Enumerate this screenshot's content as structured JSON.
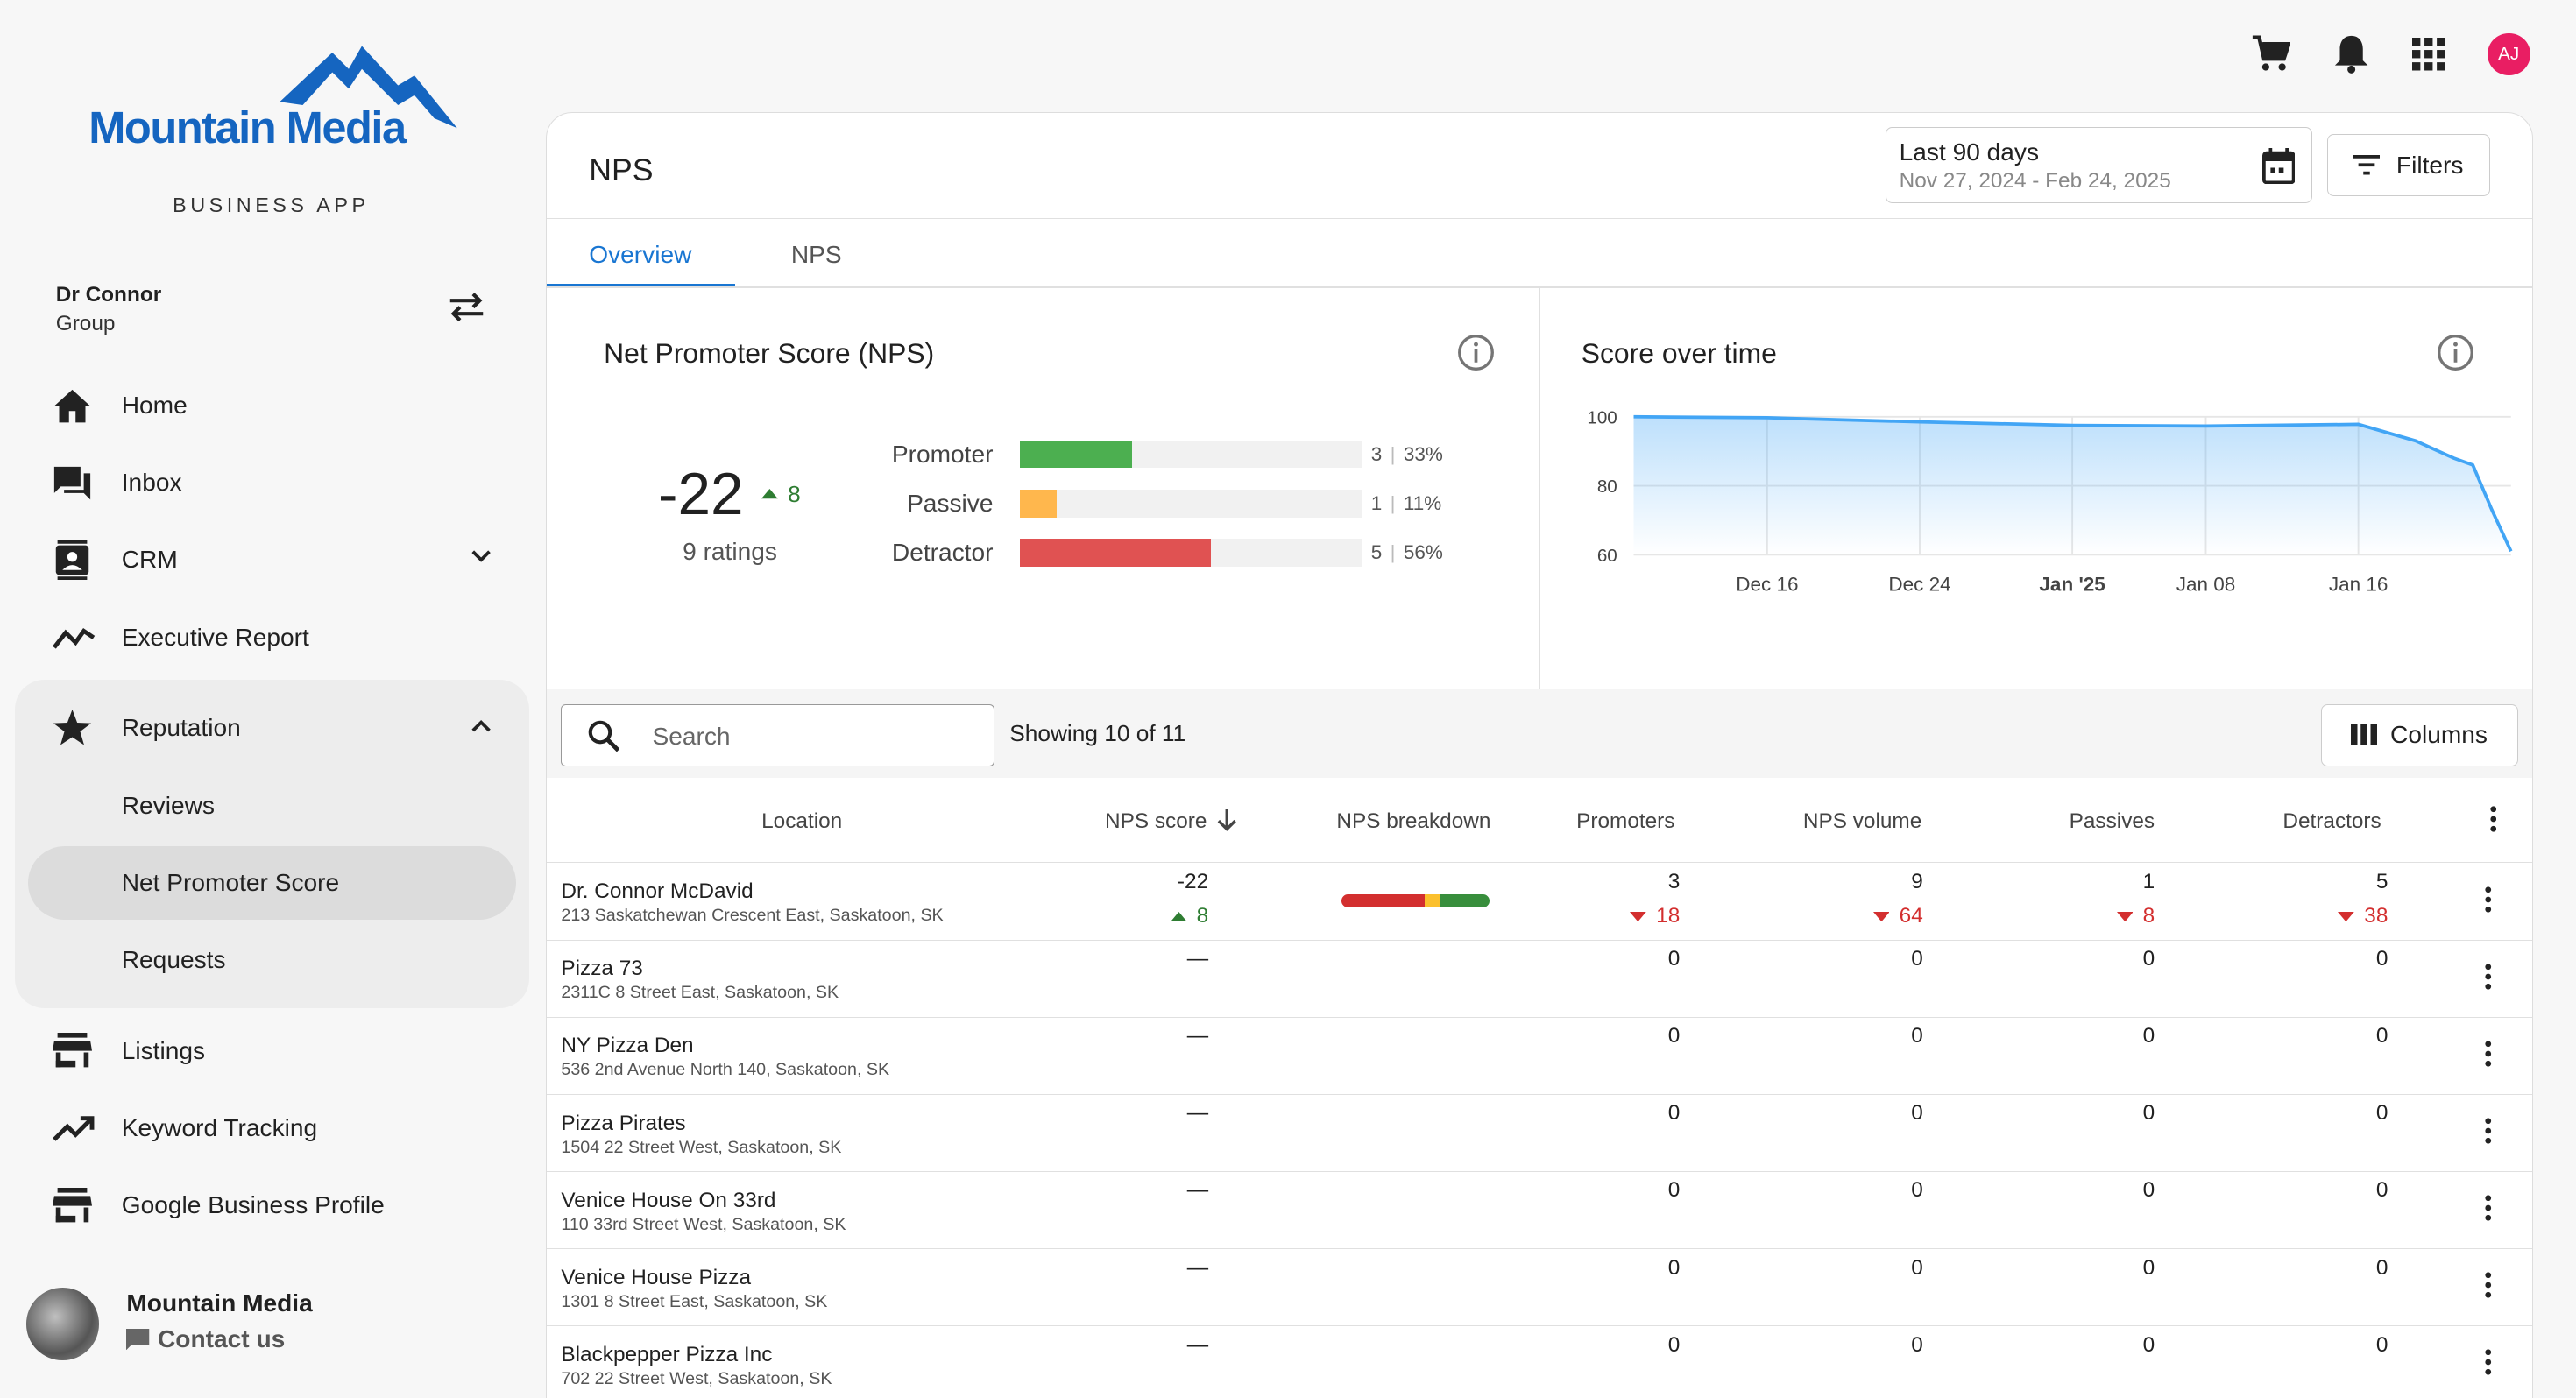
{
  "brand": {
    "name": "Mountain Media",
    "subtitle": "BUSINESS APP"
  },
  "account": {
    "name": "Dr Connor",
    "type": "Group"
  },
  "nav": {
    "home": "Home",
    "inbox": "Inbox",
    "crm": "CRM",
    "executive_report": "Executive Report",
    "reputation": "Reputation",
    "reviews": "Reviews",
    "net_promoter_score": "Net Promoter Score",
    "requests": "Requests",
    "listings": "Listings",
    "keyword_tracking": "Keyword Tracking",
    "google_business_profile": "Google Business Profile"
  },
  "footer": {
    "name": "Mountain Media",
    "contact": "Contact us"
  },
  "user": {
    "initials": "AJ"
  },
  "page": {
    "title": "NPS",
    "date_label": "Last 90 days",
    "date_range": "Nov 27, 2024 - Feb 24, 2025",
    "filters": "Filters",
    "tabs": [
      "Overview",
      "NPS"
    ]
  },
  "nps_card": {
    "title": "Net Promoter Score (NPS)",
    "score": "-22",
    "delta": "8",
    "ratings": "9 ratings",
    "rows": [
      {
        "label": "Promoter",
        "count": "3",
        "percent": "33%",
        "value": 0.33,
        "color": "#4caf50"
      },
      {
        "label": "Passive",
        "count": "1",
        "percent": "11%",
        "value": 0.11,
        "color": "#ffb74d"
      },
      {
        "label": "Detractor",
        "count": "5",
        "percent": "56%",
        "value": 0.56,
        "color": "#e05252"
      }
    ]
  },
  "chart_data": {
    "type": "area",
    "title": "Score over time",
    "x_ticks": [
      "Dec 16",
      "Dec 24",
      "Jan '25",
      "Jan 08",
      "Jan 16"
    ],
    "y_ticks": [
      "100",
      "80",
      "60"
    ],
    "ylim": [
      60,
      100
    ],
    "xlim": [
      "2024-12-09",
      "2025-01-24"
    ],
    "x": [
      "2024-12-09",
      "2024-12-16",
      "2024-12-24",
      "2025-01-01",
      "2025-01-08",
      "2025-01-16",
      "2025-01-19",
      "2025-01-21",
      "2025-01-22",
      "2025-01-23",
      "2025-01-24"
    ],
    "y": [
      100,
      99.7,
      98.5,
      97.5,
      97.3,
      97.8,
      93,
      88,
      86,
      73,
      61
    ],
    "color": "#42a5f5"
  },
  "table": {
    "search_placeholder": "Search",
    "showing": "Showing 10 of 11",
    "columns_label": "Columns",
    "headers": {
      "location": "Location",
      "nps_score": "NPS score",
      "nps_breakdown": "NPS breakdown",
      "promoters": "Promoters",
      "nps_volume": "NPS volume",
      "passives": "Passives",
      "detractors": "Detractors"
    },
    "rows": [
      {
        "name": "Dr. Connor McDavid",
        "address": "213 Saskatchewan Crescent East, Saskatoon, SK",
        "score": "-22",
        "score_delta": "8",
        "promoters": "3",
        "promoters_delta": "18",
        "volume": "9",
        "volume_delta": "64",
        "passives": "1",
        "passives_delta": "8",
        "detractors": "5",
        "detractors_delta": "38",
        "breakdown": {
          "detractor": 0.56,
          "passive": 0.11,
          "promoter": 0.33
        }
      },
      {
        "name": "Pizza 73",
        "address": "2311C 8 Street East, Saskatoon, SK",
        "score": "—",
        "promoters": "0",
        "volume": "0",
        "passives": "0",
        "detractors": "0"
      },
      {
        "name": "NY Pizza Den",
        "address": "536 2nd Avenue North 140, Saskatoon, SK",
        "score": "—",
        "promoters": "0",
        "volume": "0",
        "passives": "0",
        "detractors": "0"
      },
      {
        "name": "Pizza Pirates",
        "address": "1504 22 Street West, Saskatoon, SK",
        "score": "—",
        "promoters": "0",
        "volume": "0",
        "passives": "0",
        "detractors": "0"
      },
      {
        "name": "Venice House On 33rd",
        "address": "110 33rd Street West, Saskatoon, SK",
        "score": "—",
        "promoters": "0",
        "volume": "0",
        "passives": "0",
        "detractors": "0"
      },
      {
        "name": "Venice House Pizza",
        "address": "1301 8 Street East, Saskatoon, SK",
        "score": "—",
        "promoters": "0",
        "volume": "0",
        "passives": "0",
        "detractors": "0"
      },
      {
        "name": "Blackpepper Pizza Inc",
        "address": "702 22 Street West, Saskatoon, SK",
        "score": "—",
        "promoters": "0",
        "volume": "0",
        "passives": "0",
        "detractors": "0"
      }
    ]
  }
}
